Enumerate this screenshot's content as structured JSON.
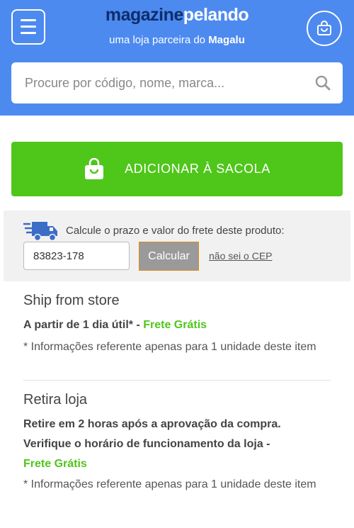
{
  "header": {
    "brand_part1": "magazine",
    "brand_part2": "pelando",
    "tagline_prefix": "uma loja parceira do ",
    "tagline_brand": "Magalu"
  },
  "search": {
    "placeholder": "Procure por código, nome, marca..."
  },
  "cart": {
    "add_label": "ADICIONAR À SACOLA"
  },
  "freight": {
    "label": "Calcule o prazo e valor do frete deste produto:",
    "cep_value": "83823-178",
    "calc_label": "Calcular",
    "no_cep_label": "não sei o CEP"
  },
  "options": [
    {
      "title": "Ship from store",
      "line1": "A partir de 1 dia útil* - ",
      "free": "Frete Grátis",
      "note": "* Informações referente apenas para 1 unidade deste item"
    },
    {
      "title": "Retira loja",
      "line1": "Retire em 2 horas após a aprovação da compra.",
      "line2": "Verifique o horário de funcionamento da loja -",
      "free": "Frete Grátis",
      "note": "* Informações referente apenas para 1 unidade deste item"
    }
  ],
  "colors": {
    "header_blue": "#4d8af0",
    "green": "#4fc61a",
    "brand_dark": "#0d2e6b"
  },
  "icons": [
    "menu-icon",
    "bag-icon",
    "search-icon",
    "truck-icon"
  ]
}
